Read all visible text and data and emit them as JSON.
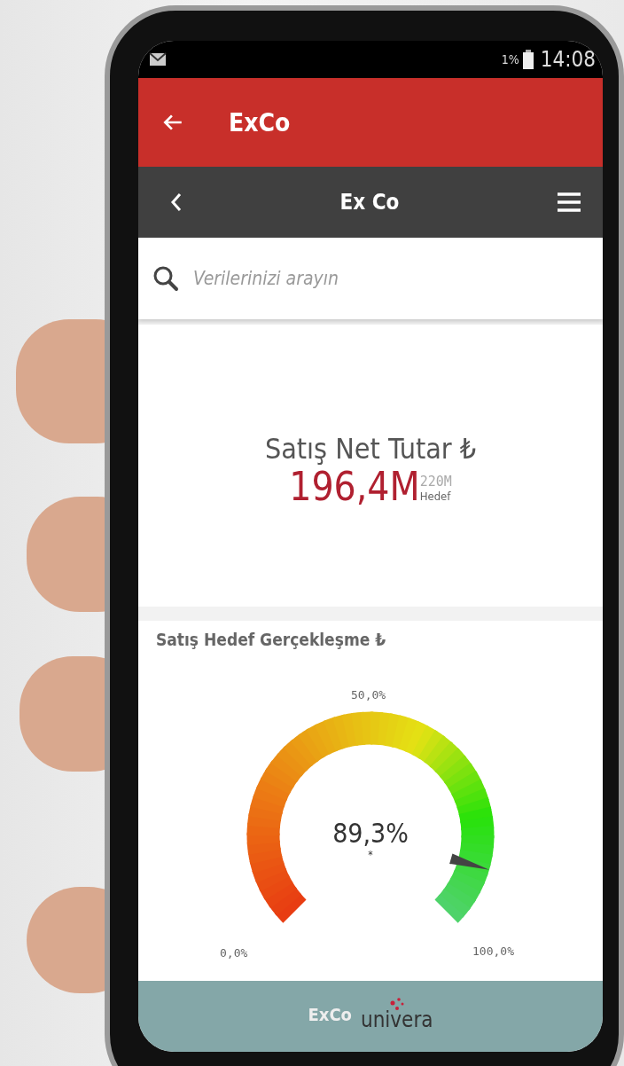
{
  "status_bar": {
    "battery": "1%",
    "time": "14:08"
  },
  "app_bar": {
    "title": "ExCo"
  },
  "sub_bar": {
    "title": "Ex Co"
  },
  "search": {
    "placeholder": "Verilerinizi arayın"
  },
  "kpi": {
    "title": "Satış Net Tutar ₺",
    "value": "196,4M",
    "target": "220M",
    "target_label": "Hedef"
  },
  "gauge": {
    "title": "Satış Hedef Gerçekleşme ₺",
    "reading": "89,3%",
    "mark": "*",
    "level": 0.893,
    "tick_min": "0,0%",
    "tick_mid": "50,0%",
    "tick_max": "100,0%"
  },
  "footer": {
    "app_name": "ExCo",
    "brand": "univera"
  }
}
